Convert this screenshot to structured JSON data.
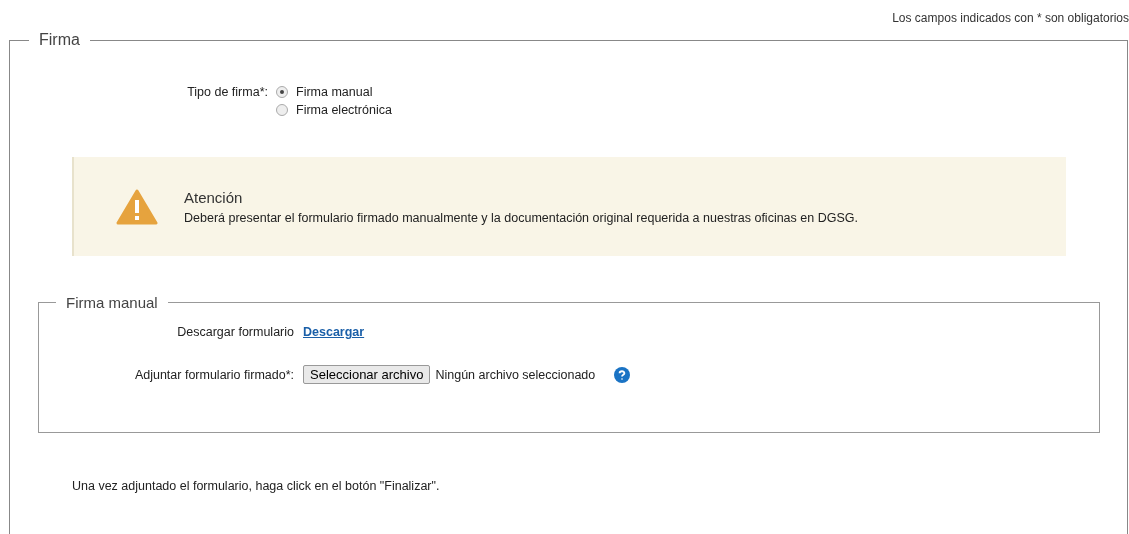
{
  "required_note": "Los campos indicados con * son obligatorios",
  "section": {
    "legend": "Firma",
    "signature_type": {
      "label": "Tipo de firma*:",
      "options": [
        {
          "label": "Firma manual",
          "selected": true
        },
        {
          "label": "Firma electrónica",
          "selected": false
        }
      ]
    },
    "alert": {
      "title": "Atención",
      "message": "Deberá presentar el formulario firmado manualmente y la documentación original requerida a nuestras oficinas en DGSG."
    },
    "manual": {
      "legend": "Firma manual",
      "download": {
        "label": "Descargar formulario",
        "link": "Descargar"
      },
      "attach": {
        "label": "Adjuntar formulario firmado*:",
        "button": "Seleccionar archivo",
        "status": "Ningún archivo seleccionado"
      }
    },
    "footer": "Una vez adjuntado el formulario, haga click en el botón \"Finalizar\"."
  }
}
